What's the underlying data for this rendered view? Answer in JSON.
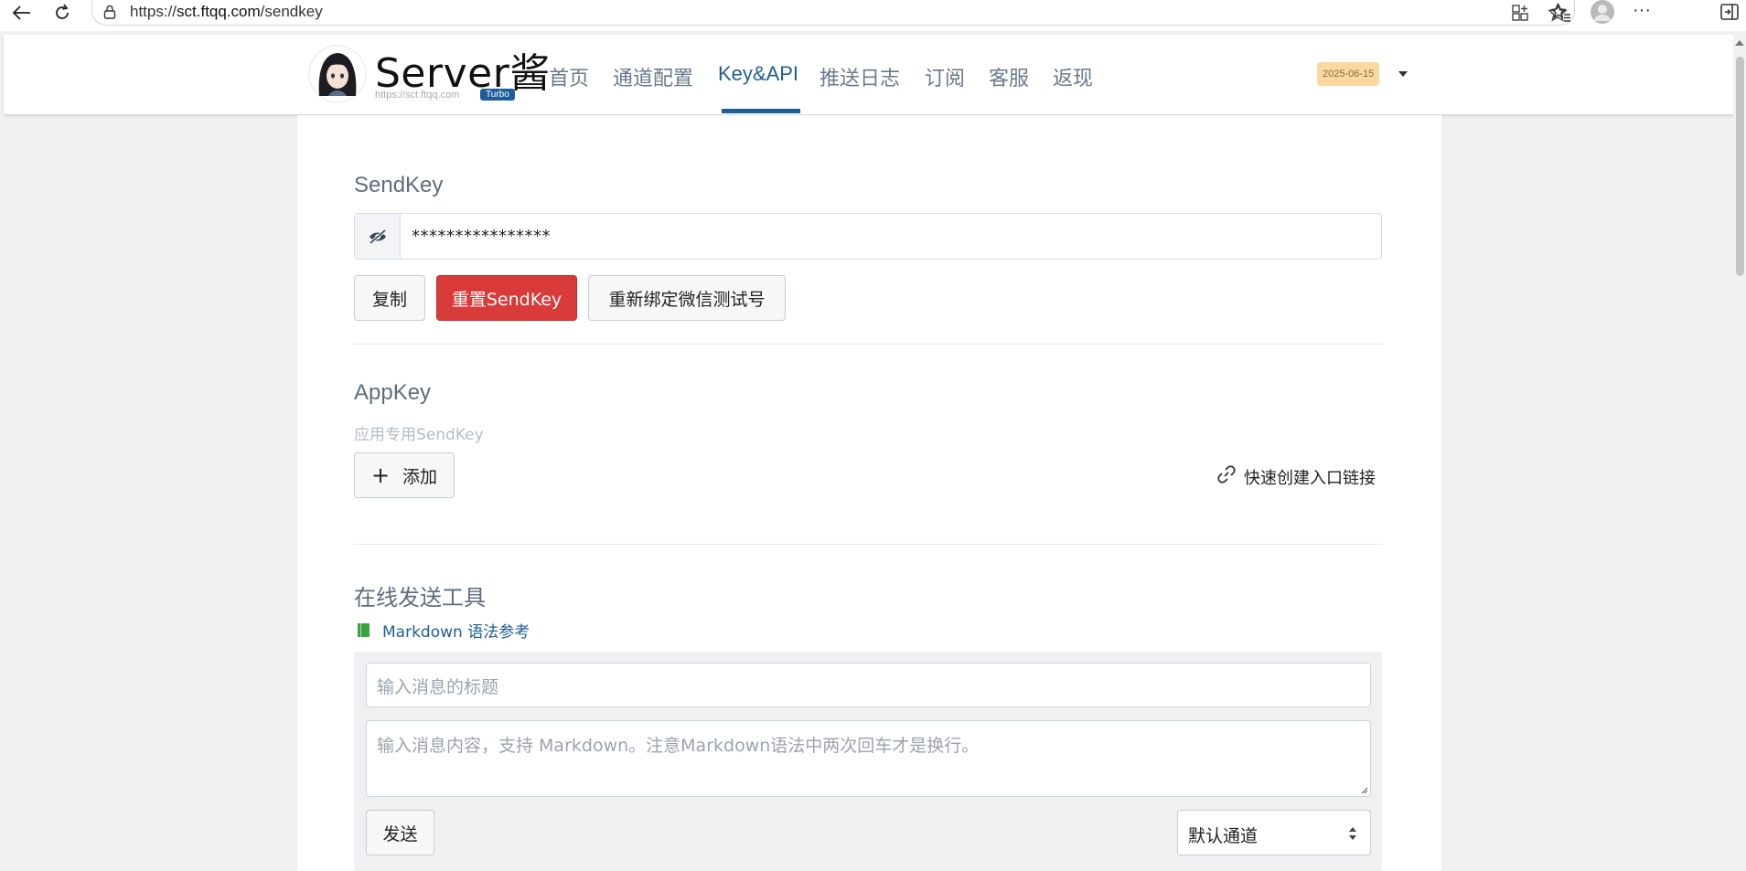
{
  "browser": {
    "url_prefix": "https://",
    "url_host": "sct.ftqq.com",
    "url_path": "/sendkey"
  },
  "header": {
    "brand": "Server酱",
    "brand_url": "https://sct.ftqq.com",
    "badge": "Turbo",
    "nav": [
      {
        "label": "首页",
        "active": false
      },
      {
        "label": "通道配置",
        "active": false
      },
      {
        "label": "Key&API",
        "active": true
      },
      {
        "label": "推送日志",
        "active": false
      },
      {
        "label": "订阅",
        "active": false
      },
      {
        "label": "客服",
        "active": false
      },
      {
        "label": "返现",
        "active": false
      }
    ],
    "date": "2025-06-15"
  },
  "sendkey": {
    "title": "SendKey",
    "masked_value": "****************",
    "copy_label": "复制",
    "reset_label": "重置SendKey",
    "rebind_label": "重新绑定微信测试号"
  },
  "appkey": {
    "title": "AppKey",
    "subtitle": "应用专用SendKey",
    "add_label": "添加",
    "quick_link_label": "快速创建入口链接"
  },
  "online_tool": {
    "title": "在线发送工具",
    "markdown_link": "Markdown 语法参考",
    "title_placeholder": "输入消息的标题",
    "content_placeholder": "输入消息内容，支持 Markdown。注意Markdown语法中两次回车才是换行。",
    "send_label": "发送",
    "channel_selected": "默认通道"
  },
  "colors": {
    "accent": "#1f5f92",
    "danger": "#d93a3a",
    "date_badge": "#fbd8a2"
  }
}
